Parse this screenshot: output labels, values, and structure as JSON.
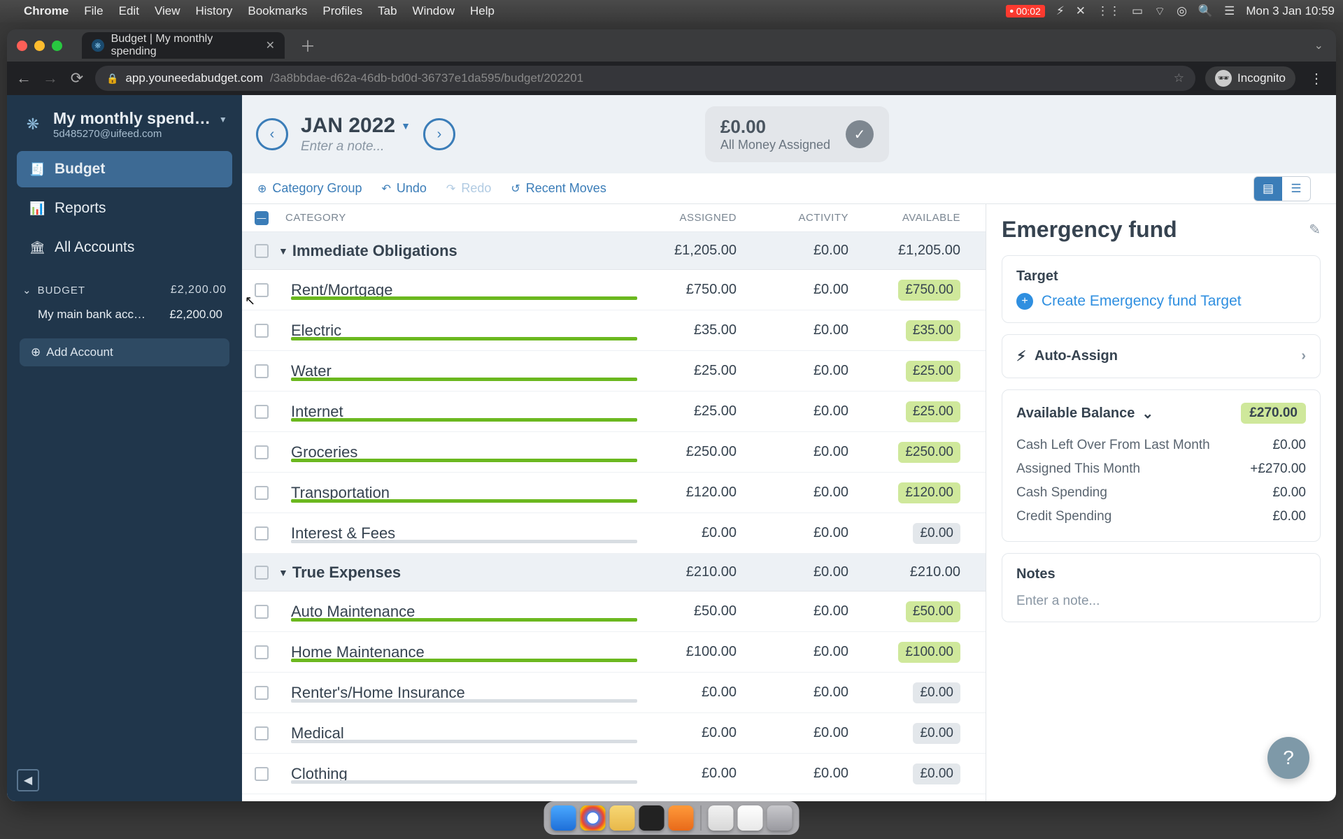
{
  "menubar": {
    "app": "Chrome",
    "menus": [
      "File",
      "Edit",
      "View",
      "History",
      "Bookmarks",
      "Profiles",
      "Tab",
      "Window",
      "Help"
    ],
    "rec_time": "00:02",
    "clock": "Mon 3 Jan  10:59"
  },
  "browser": {
    "tab_title": "Budget | My monthly spending",
    "url_domain": "app.youneedabudget.com",
    "url_path": "/3a8bbdae-d62a-46db-bd0d-36737e1da595/budget/202201",
    "incognito": "Incognito"
  },
  "sidebar": {
    "budget_name": "My monthly spend…",
    "email": "5d485270@uifeed.com",
    "nav": {
      "budget": "Budget",
      "reports": "Reports",
      "accounts": "All Accounts"
    },
    "section_label": "BUDGET",
    "section_total": "£2,200.00",
    "account_name": "My main bank acc…",
    "account_balance": "£2,200.00",
    "add_account": "Add Account"
  },
  "header": {
    "month": "JAN 2022",
    "note_placeholder": "Enter a note...",
    "status_amount": "£0.00",
    "status_label": "All Money Assigned"
  },
  "toolbar": {
    "category_group": "Category Group",
    "undo": "Undo",
    "redo": "Redo",
    "recent": "Recent Moves"
  },
  "columns": {
    "category": "CATEGORY",
    "assigned": "ASSIGNED",
    "activity": "ACTIVITY",
    "available": "AVAILABLE"
  },
  "groups": [
    {
      "name": "Immediate Obligations",
      "assigned": "£1,205.00",
      "activity": "£0.00",
      "available": "£1,205.00",
      "rows": [
        {
          "name": "Rent/Mortgage",
          "assigned": "£750.00",
          "activity": "£0.00",
          "available": "£750.00",
          "prog": "green"
        },
        {
          "name": "Electric",
          "assigned": "£35.00",
          "activity": "£0.00",
          "available": "£35.00",
          "prog": "green"
        },
        {
          "name": "Water",
          "assigned": "£25.00",
          "activity": "£0.00",
          "available": "£25.00",
          "prog": "green"
        },
        {
          "name": "Internet",
          "assigned": "£25.00",
          "activity": "£0.00",
          "available": "£25.00",
          "prog": "green"
        },
        {
          "name": "Groceries",
          "assigned": "£250.00",
          "activity": "£0.00",
          "available": "£250.00",
          "prog": "green"
        },
        {
          "name": "Transportation",
          "assigned": "£120.00",
          "activity": "£0.00",
          "available": "£120.00",
          "prog": "green"
        },
        {
          "name": "Interest & Fees",
          "assigned": "£0.00",
          "activity": "£0.00",
          "available": "£0.00",
          "prog": "gray"
        }
      ]
    },
    {
      "name": "True Expenses",
      "assigned": "£210.00",
      "activity": "£0.00",
      "available": "£210.00",
      "rows": [
        {
          "name": "Auto Maintenance",
          "assigned": "£50.00",
          "activity": "£0.00",
          "available": "£50.00",
          "prog": "green"
        },
        {
          "name": "Home Maintenance",
          "assigned": "£100.00",
          "activity": "£0.00",
          "available": "£100.00",
          "prog": "green"
        },
        {
          "name": "Renter's/Home Insurance",
          "assigned": "£0.00",
          "activity": "£0.00",
          "available": "£0.00",
          "prog": "gray"
        },
        {
          "name": "Medical",
          "assigned": "£0.00",
          "activity": "£0.00",
          "available": "£0.00",
          "prog": "gray"
        },
        {
          "name": "Clothing",
          "assigned": "£0.00",
          "activity": "£0.00",
          "available": "£0.00",
          "prog": "gray"
        }
      ]
    }
  ],
  "inspector": {
    "title": "Emergency fund",
    "target_label": "Target",
    "create_target": "Create Emergency fund Target",
    "auto_assign": "Auto-Assign",
    "balance_label": "Available Balance",
    "balance_amount": "£270.00",
    "rows": [
      {
        "label": "Cash Left Over From Last Month",
        "value": "£0.00"
      },
      {
        "label": "Assigned This Month",
        "value": "+£270.00"
      },
      {
        "label": "Cash Spending",
        "value": "£0.00"
      },
      {
        "label": "Credit Spending",
        "value": "£0.00"
      }
    ],
    "notes_label": "Notes",
    "notes_placeholder": "Enter a note..."
  },
  "dock_apps": [
    "finder",
    "chrome",
    "notes",
    "terminal",
    "app",
    "textedit",
    "pages",
    "trash"
  ]
}
